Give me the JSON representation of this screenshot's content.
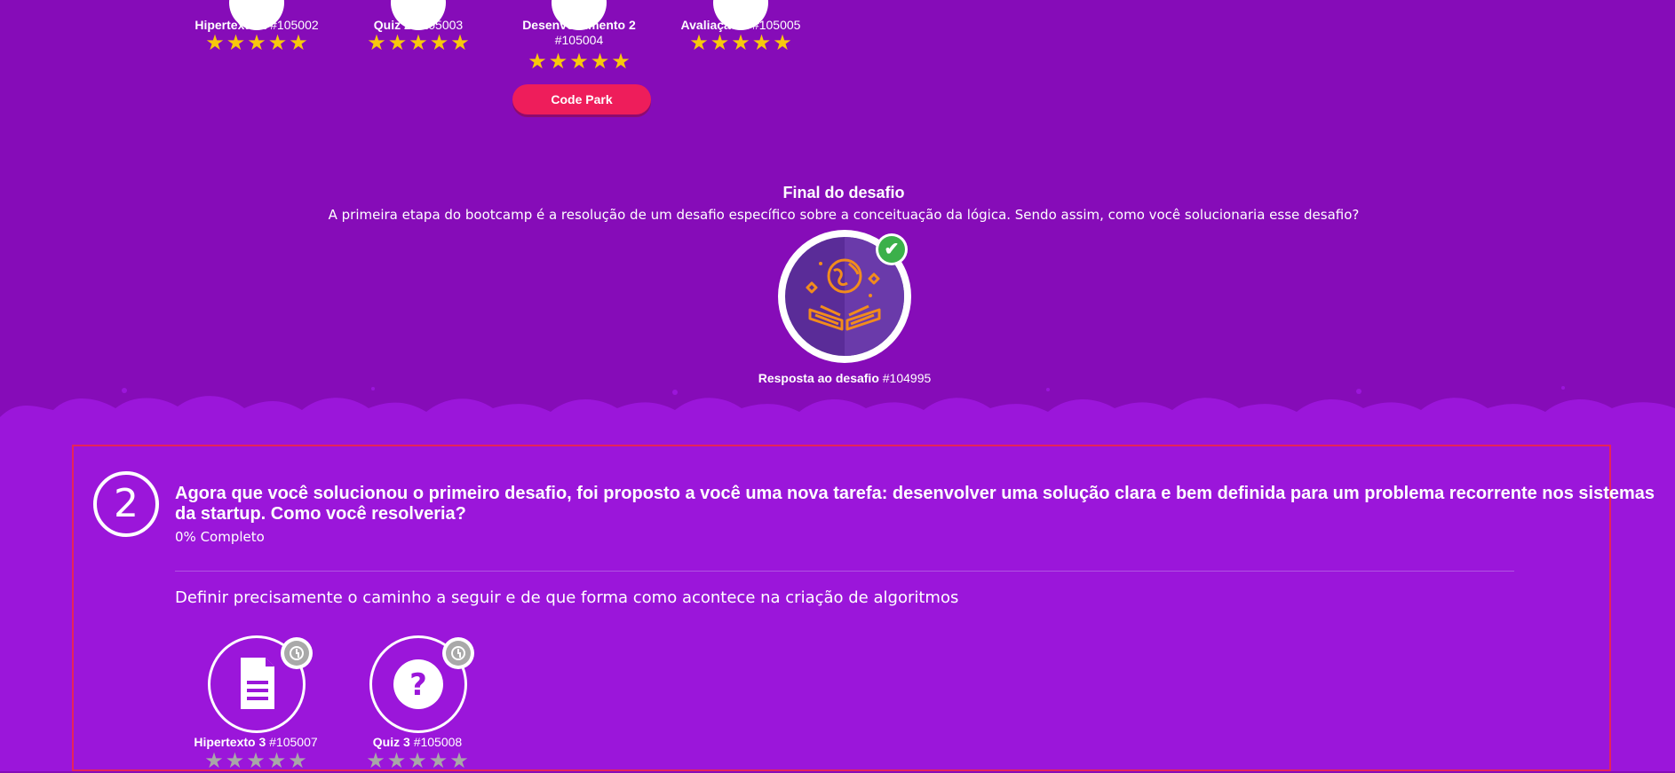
{
  "top_activities": [
    {
      "name": "Hipertexto 2",
      "id": "#105002",
      "stars": 5
    },
    {
      "name": "Quiz 2",
      "id": "#105003",
      "stars": 5
    },
    {
      "name": "Desenvolvimento 2",
      "id": "#105004",
      "stars": 5
    },
    {
      "name": "Avaliação 2",
      "id": "#105005",
      "stars": 5
    }
  ],
  "code_park_label": "Code Park",
  "final": {
    "title": "Final do desafio",
    "description": "A primeira etapa do bootcamp é a resolução de um desafio específico sobre a conceituação da lógica. Sendo assim, como você solucionaria esse desafio?",
    "badge_name": "Resposta ao desafio",
    "badge_id": "#104995",
    "completed": true
  },
  "section": {
    "number": "2",
    "title": "Agora que você solucionou o primeiro desafio, foi proposto a você uma nova tarefa: desenvolver uma solução clara e bem definida para um problema recorrente nos sistemas da startup. Como você resolveria?",
    "progress": "0% Completo",
    "description": "Definir precisamente o caminho a seguir e de que forma como acontece na criação de algoritmos",
    "activities": [
      {
        "name": "Hipertexto 3",
        "id": "#105007",
        "icon": "document-icon",
        "stars": 0
      },
      {
        "name": "Quiz 3",
        "id": "#105008",
        "icon": "question-icon",
        "stars": 0
      }
    ]
  },
  "colors": {
    "background_upper": "#860cb8",
    "background_lower": "#9b16da",
    "star_filled": "#f8c80c",
    "star_empty": "#a8a8a8",
    "button": "#ee1d5b",
    "highlight_border": "#e5245a",
    "check": "#3bb04a"
  }
}
